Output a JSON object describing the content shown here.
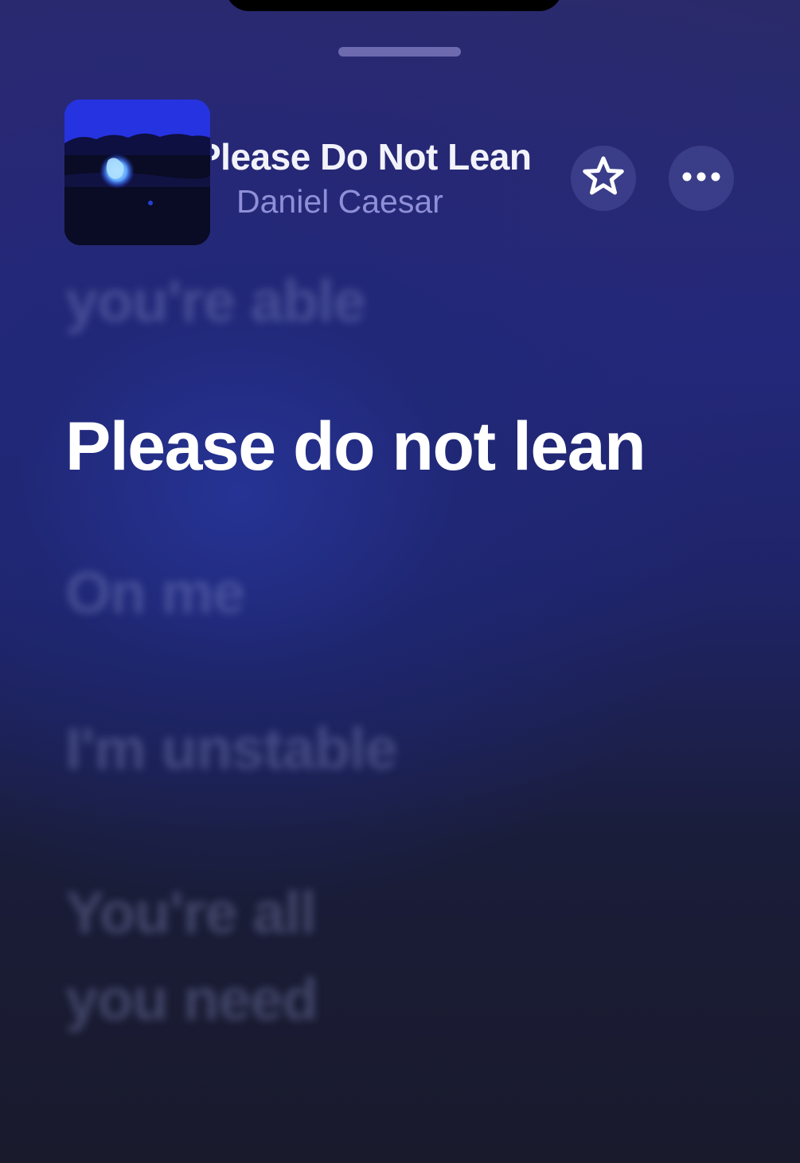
{
  "now_playing": {
    "title": "Please Do Not Lean",
    "artist": "Daniel Caesar"
  },
  "lyrics": {
    "previous": "you're able",
    "current": "Please do not lean",
    "upcoming": [
      "On me",
      "I'm unstable",
      "You're all",
      "you need"
    ]
  },
  "icons": {
    "favorite": "star-outline-icon",
    "more": "ellipsis-icon"
  },
  "colors": {
    "background_top": "#2a2a6a",
    "background_mid": "#23287a",
    "background_bottom": "#191a2c",
    "artist_text": "#8f8fd8",
    "active_lyric": "#ffffff"
  }
}
